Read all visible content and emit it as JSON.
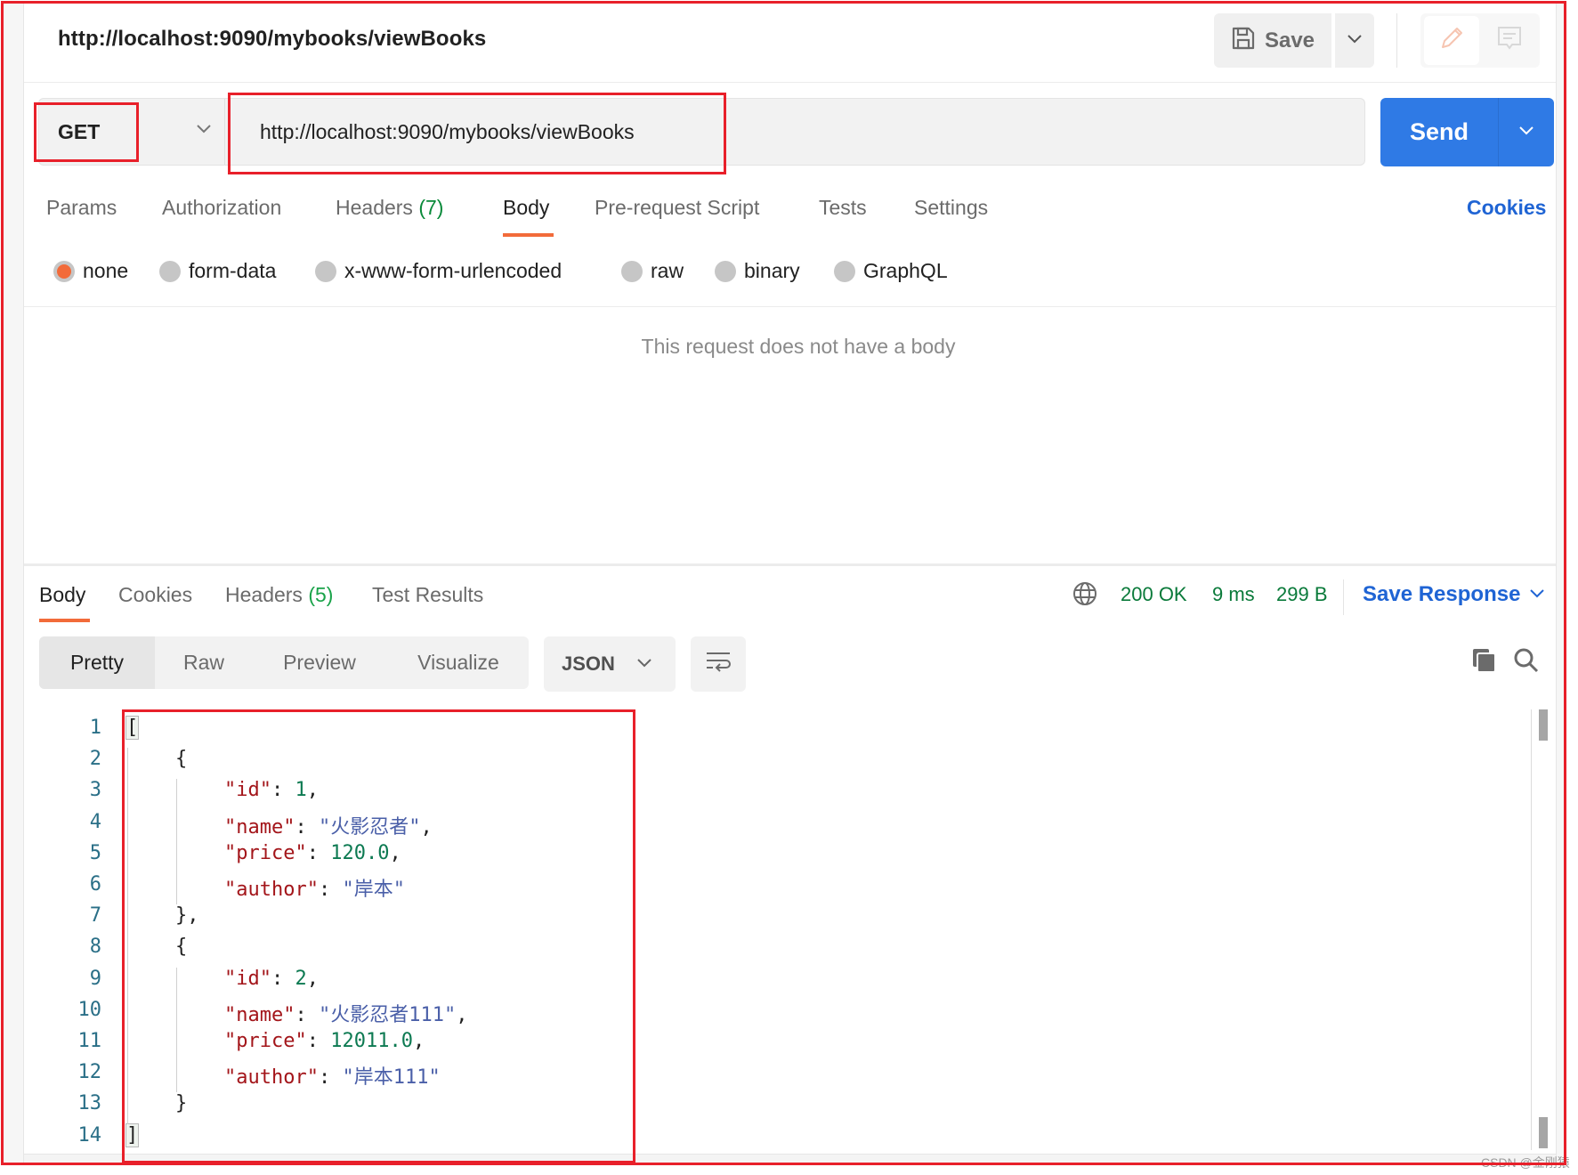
{
  "header": {
    "title": "http://localhost:9090/mybooks/viewBooks",
    "save_label": "Save"
  },
  "request": {
    "method": "GET",
    "url": "http://localhost:9090/mybooks/viewBooks",
    "send_label": "Send",
    "tabs": [
      {
        "label": "Params",
        "count": ""
      },
      {
        "label": "Authorization",
        "count": ""
      },
      {
        "label": "Headers",
        "count": "(7)"
      },
      {
        "label": "Body",
        "count": ""
      },
      {
        "label": "Pre-request Script",
        "count": ""
      },
      {
        "label": "Tests",
        "count": ""
      },
      {
        "label": "Settings",
        "count": ""
      }
    ],
    "active_tab": "Body",
    "cookies_label": "Cookies",
    "body_types": [
      "none",
      "form-data",
      "x-www-form-urlencoded",
      "raw",
      "binary",
      "GraphQL"
    ],
    "selected_body_type": "none",
    "empty_body_message": "This request does not have a body"
  },
  "response": {
    "tabs": [
      {
        "label": "Body",
        "count": ""
      },
      {
        "label": "Cookies",
        "count": ""
      },
      {
        "label": "Headers",
        "count": "(5)"
      },
      {
        "label": "Test Results",
        "count": ""
      }
    ],
    "active_tab": "Body",
    "status": "200 OK",
    "time": "9 ms",
    "size": "299 B",
    "save_response_label": "Save Response",
    "view_modes": [
      "Pretty",
      "Raw",
      "Preview",
      "Visualize"
    ],
    "active_view": "Pretty",
    "format": "JSON",
    "line_numbers": [
      "1",
      "2",
      "3",
      "4",
      "5",
      "6",
      "7",
      "8",
      "9",
      "10",
      "11",
      "12",
      "13",
      "14"
    ],
    "books": [
      {
        "id": "1",
        "name": "\"火影忍者\"",
        "price": "120.0",
        "author": "\"岸本\""
      },
      {
        "id": "2",
        "name": "\"火影忍者111\"",
        "price": "12011.0",
        "author": "\"岸本111\""
      }
    ],
    "keys": {
      "id": "\"id\"",
      "name": "\"name\"",
      "price": "\"price\"",
      "author": "\"author\""
    }
  },
  "colors": {
    "accent": "#f26b3a",
    "send_button": "#2f7ae5",
    "link": "#1f64d4",
    "status_ok": "#0a7a3a",
    "annotation": "#e8202a"
  },
  "watermark": "CSDN @金刚猿"
}
